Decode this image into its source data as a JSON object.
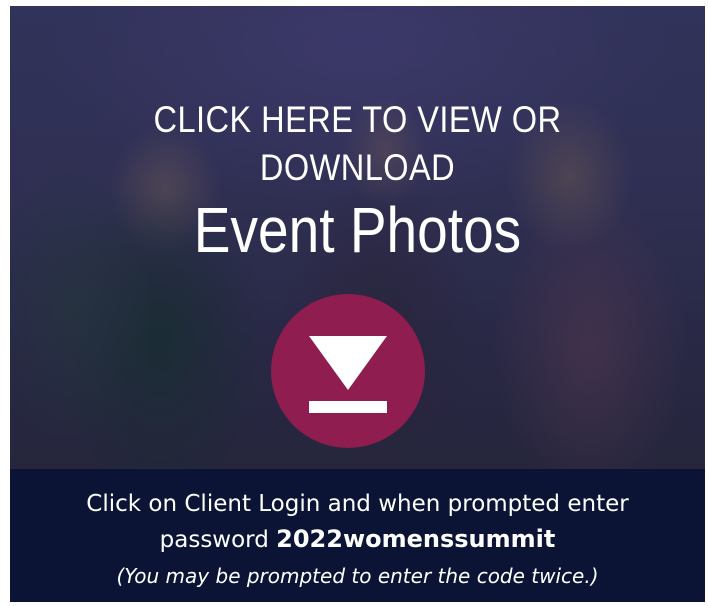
{
  "banner": {
    "headline_line1": "CLICK HERE TO VIEW OR",
    "headline_line2": "DOWNLOAD",
    "headline_line3": "Event Photos",
    "download_icon": "download-icon",
    "accent_color": "#8f1d4f"
  },
  "footer": {
    "instruction_text": "Click on Client Login and when prompted enter",
    "password_prefix": "password ",
    "password": "2022womenssummit",
    "note": "(You may be prompted to enter the code twice.)",
    "background_color": "#0c1436"
  }
}
